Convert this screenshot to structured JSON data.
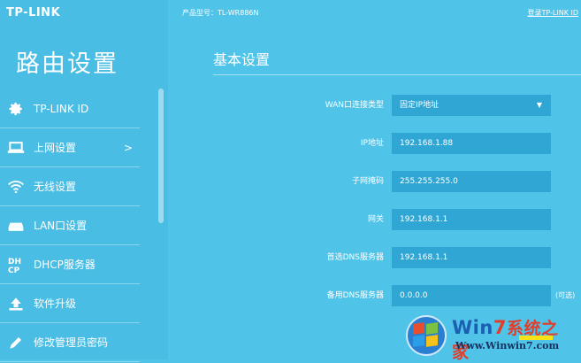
{
  "brand": "TP-LINK",
  "sidebar": {
    "title": "路由设置",
    "items": [
      {
        "label": "TP-LINK ID",
        "icon": "gear-icon"
      },
      {
        "label": "上网设置",
        "icon": "laptop-icon",
        "chevron": ">"
      },
      {
        "label": "无线设置",
        "icon": "wifi-icon"
      },
      {
        "label": "LAN口设置",
        "icon": "router-icon"
      },
      {
        "label": "DHCP服务器",
        "icon": "dhcp-icon"
      },
      {
        "label": "软件升级",
        "icon": "upload-icon"
      },
      {
        "label": "修改管理员密码",
        "icon": "pencil-icon"
      }
    ]
  },
  "header": {
    "product": "产品型号：TL-WR886N",
    "login": "登录TP-LINK ID"
  },
  "main": {
    "section_title": "基本设置",
    "wan_type": {
      "label": "WAN口连接类型",
      "value": "固定IP地址"
    },
    "ip": {
      "label": "IP地址",
      "value": "192.168.1.88"
    },
    "mask": {
      "label": "子网掩码",
      "value": "255.255.255.0"
    },
    "gateway": {
      "label": "网关",
      "value": "192.168.1.1"
    },
    "dns1": {
      "label": "首选DNS服务器",
      "value": "192.168.1.1"
    },
    "dns2": {
      "label": "备用DNS服务器",
      "value": "0.0.0.0",
      "note": "(可选)"
    }
  },
  "watermark": {
    "brand_a": "Win",
    "brand_b": "7",
    "brand_c": "系统之家",
    "url": "Www.Winwin7.com"
  },
  "colors": {
    "background": "#4fc3e8",
    "field": "#2fa6d4"
  }
}
